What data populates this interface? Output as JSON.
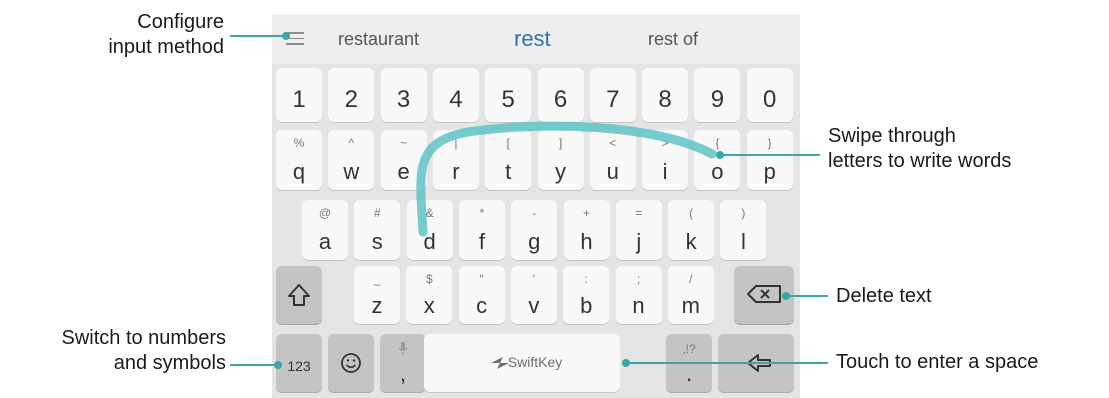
{
  "suggestions": {
    "left": "restaurant",
    "center": "rest",
    "right": "rest of"
  },
  "number_row": [
    "1",
    "2",
    "3",
    "4",
    "5",
    "6",
    "7",
    "8",
    "9",
    "0"
  ],
  "row_q": [
    {
      "main": "q",
      "sec": "%"
    },
    {
      "main": "w",
      "sec": "^"
    },
    {
      "main": "e",
      "sec": "~"
    },
    {
      "main": "r",
      "sec": "|"
    },
    {
      "main": "t",
      "sec": "["
    },
    {
      "main": "y",
      "sec": "]"
    },
    {
      "main": "u",
      "sec": "<"
    },
    {
      "main": "i",
      "sec": ">"
    },
    {
      "main": "o",
      "sec": "{"
    },
    {
      "main": "p",
      "sec": "}"
    }
  ],
  "row_a": [
    {
      "main": "a",
      "sec": "@"
    },
    {
      "main": "s",
      "sec": "#"
    },
    {
      "main": "d",
      "sec": "&"
    },
    {
      "main": "f",
      "sec": "*"
    },
    {
      "main": "g",
      "sec": "-"
    },
    {
      "main": "h",
      "sec": "+"
    },
    {
      "main": "j",
      "sec": "="
    },
    {
      "main": "k",
      "sec": "("
    },
    {
      "main": "l",
      "sec": ")"
    }
  ],
  "row_z": [
    {
      "main": "z",
      "sec": "_"
    },
    {
      "main": "x",
      "sec": "$"
    },
    {
      "main": "c",
      "sec": "\""
    },
    {
      "main": "v",
      "sec": "'"
    },
    {
      "main": "b",
      "sec": ":"
    },
    {
      "main": "n",
      "sec": ";"
    },
    {
      "main": "m",
      "sec": "/"
    }
  ],
  "bottom": {
    "numbers_label": "123",
    "comma_label": ",",
    "space_brand": "SwiftKey",
    "period_label": ".",
    "period_sec": ",!?"
  },
  "callouts": {
    "configure": "Configure\ninput method",
    "swipe": "Swipe through\nletters to write words",
    "delete": "Delete text",
    "switch": "Switch to numbers\nand symbols",
    "space": "Touch to enter a space"
  },
  "colors": {
    "accent": "#3aa6a6",
    "suggestion_primary": "#2f6fb5"
  }
}
